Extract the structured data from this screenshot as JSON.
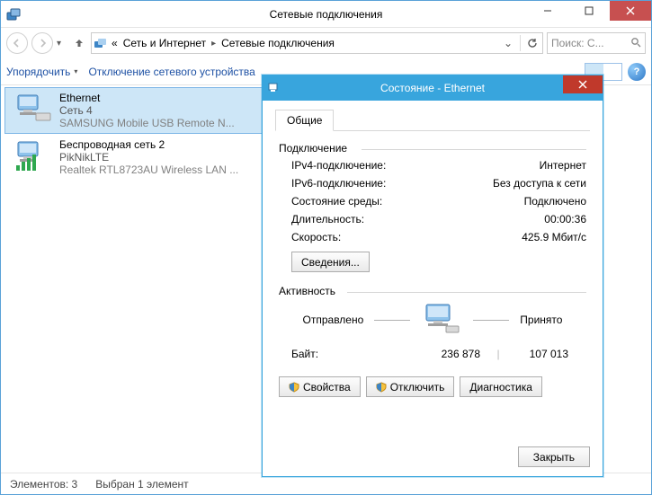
{
  "explorer": {
    "title": "Сетевые подключения",
    "breadcrumb": {
      "prefix": "«",
      "item1": "Сеть и Интернет",
      "item2": "Сетевые подключения"
    },
    "search_placeholder": "Поиск: С...",
    "toolbar": {
      "organize": "Упорядочить",
      "disable": "Отключение сетевого устройства"
    },
    "connections": [
      {
        "name": "Ethernet",
        "line2": "Сеть  4",
        "line3": "SAMSUNG Mobile USB Remote N..."
      },
      {
        "name": "Беспроводная сеть 2",
        "line2": "PikNikLTE",
        "line3": "Realtek RTL8723AU Wireless LAN ..."
      }
    ],
    "statusbar": {
      "count": "Элементов: 3",
      "selected": "Выбран 1 элемент"
    }
  },
  "status_dialog": {
    "title": "Состояние - Ethernet",
    "tab_label": "Общие",
    "connection_group": "Подключение",
    "activity_group": "Активность",
    "rows": {
      "ipv4_label": "IPv4-подключение:",
      "ipv4_value": "Интернет",
      "ipv6_label": "IPv6-подключение:",
      "ipv6_value": "Без доступа к сети",
      "media_label": "Состояние среды:",
      "media_value": "Подключено",
      "duration_label": "Длительность:",
      "duration_value": "00:00:36",
      "speed_label": "Скорость:",
      "speed_value": "425.9 Мбит/с"
    },
    "details_button": "Сведения...",
    "activity_sent": "Отправлено",
    "activity_recv": "Принято",
    "bytes_label": "Байт:",
    "bytes_sent": "236 878",
    "bytes_recv": "107 013",
    "properties_button": "Свойства",
    "disable_button": "Отключить",
    "diagnose_button": "Диагностика",
    "close_button": "Закрыть"
  }
}
